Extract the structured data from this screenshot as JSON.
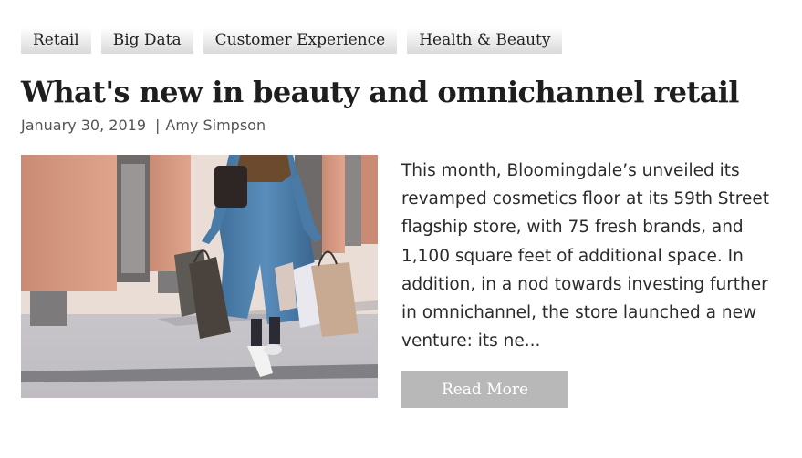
{
  "tags": [
    "Retail",
    "Big Data",
    "Customer Experience",
    "Health & Beauty"
  ],
  "post": {
    "title": "What's new in beauty and omnichannel retail",
    "date": "January 30, 2019",
    "separator": "|",
    "author": "Amy Simpson",
    "excerpt": "This month, Bloomingdale’s unveiled its revamped cosmetics floor at its 59th Street flagship store, with 75 fresh brands, and 1,100 square feet of additional space. In addition, in a nod towards investing further in omnichannel, the store launched a new venture: its ne...",
    "read_more_label": "Read More",
    "image_alt": "Woman walking with shopping bags"
  }
}
